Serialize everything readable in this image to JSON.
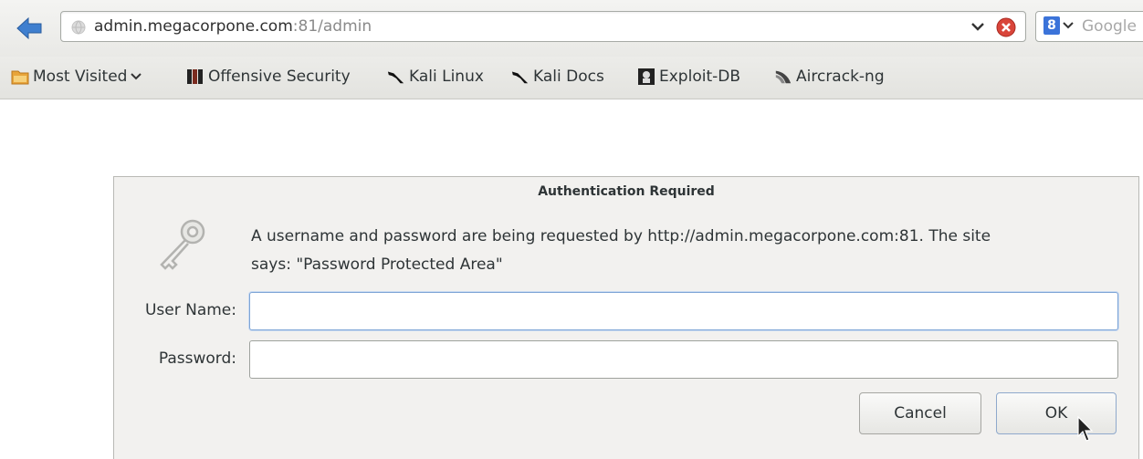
{
  "navbar": {
    "url_host": "admin.megacorpone.com",
    "url_rest": ":81/admin",
    "search_placeholder": "Google",
    "search_engine_badge": "8"
  },
  "bookmarks": [
    {
      "label": "Most Visited",
      "icon": "folder-icon"
    },
    {
      "label": "Offensive Security",
      "icon": "offsec-icon"
    },
    {
      "label": "Kali Linux",
      "icon": "kali-dragon-icon"
    },
    {
      "label": "Kali Docs",
      "icon": "kali-dragon-icon"
    },
    {
      "label": "Exploit-DB",
      "icon": "exploitdb-icon"
    },
    {
      "label": "Aircrack-ng",
      "icon": "aircrack-icon"
    }
  ],
  "dialog": {
    "title": "Authentication Required",
    "message_line1": "A username and password are being requested by http://admin.megacorpone.com:81. The site",
    "message_line2": "says: \"Password Protected Area\"",
    "username_label": "User Name:",
    "password_label": "Password:",
    "username_value": "",
    "password_value": "",
    "cancel_label": "Cancel",
    "ok_label": "OK"
  },
  "colors": {
    "accent": "#3b73d9",
    "stop_red": "#d9453a"
  }
}
